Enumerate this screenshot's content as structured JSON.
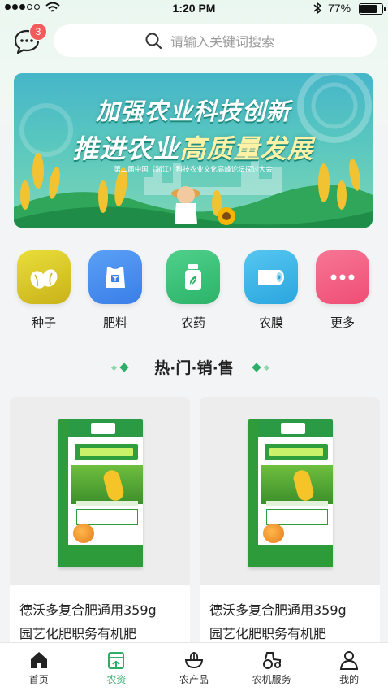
{
  "status_bar": {
    "time": "1:20 PM",
    "battery": "77%",
    "battery_level": 0.77
  },
  "header": {
    "message_badge": "3",
    "search_placeholder": "请输入关键词搜索"
  },
  "banner": {
    "title_line1": "加强农业科技创新",
    "title_line2_a": "推进农业",
    "title_line2_b": "高质量发展",
    "subtitle": "第二届中国（浙江）科技农业文化高峰论坛探讨大会"
  },
  "categories": [
    {
      "label": "种子",
      "icon": "seed-icon",
      "color": "#d6c21c"
    },
    {
      "label": "肥料",
      "icon": "fertilizer-bag-icon",
      "color": "#4a8ff0"
    },
    {
      "label": "农药",
      "icon": "pesticide-bottle-icon",
      "color": "#3cc27a"
    },
    {
      "label": "农膜",
      "icon": "film-roll-icon",
      "color": "#38b3e8"
    },
    {
      "label": "更多",
      "icon": "more-dots-icon",
      "color": "#f3567a"
    }
  ],
  "section": {
    "title": "热·门·销·售"
  },
  "products": [
    {
      "title_line1": "德沃多复合肥通用359g",
      "title_line2": "园艺化肥职务有机肥"
    },
    {
      "title_line1": "德沃多复合肥通用359g",
      "title_line2": "园艺化肥职务有机肥"
    }
  ],
  "tabbar": {
    "items": [
      {
        "label": "首页",
        "icon": "home-icon",
        "active": false
      },
      {
        "label": "农资",
        "icon": "farm-supply-icon",
        "active": true
      },
      {
        "label": "农产品",
        "icon": "produce-icon",
        "active": false
      },
      {
        "label": "农机服务",
        "icon": "tractor-icon",
        "active": false
      },
      {
        "label": "我的",
        "icon": "profile-icon",
        "active": false
      }
    ]
  },
  "colors": {
    "accent": "#2fae6a",
    "badge": "#f25c5c"
  }
}
